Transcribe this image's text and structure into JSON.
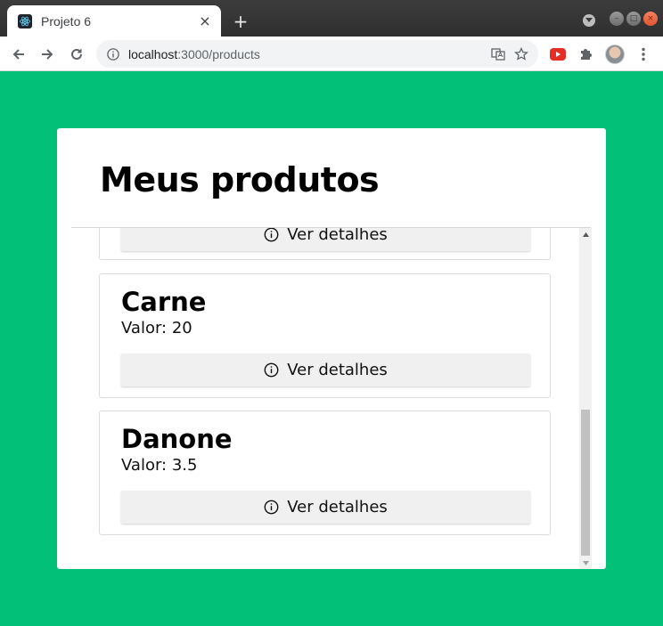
{
  "browser": {
    "tab_title": "Projeto 6",
    "tab_close": "×",
    "new_tab": "+",
    "url_host": "localhost",
    "url_rest": ":3000/products"
  },
  "page": {
    "title": "Meus produtos",
    "details_label": "Ver detalhes",
    "products": [
      {
        "name": "Carne",
        "value_text": "Valor: 20"
      },
      {
        "name": "Danone",
        "value_text": "Valor: 3.5"
      }
    ]
  },
  "colors": {
    "background": "#02c077",
    "card": "#ffffff",
    "button": "#f0f0f0"
  }
}
